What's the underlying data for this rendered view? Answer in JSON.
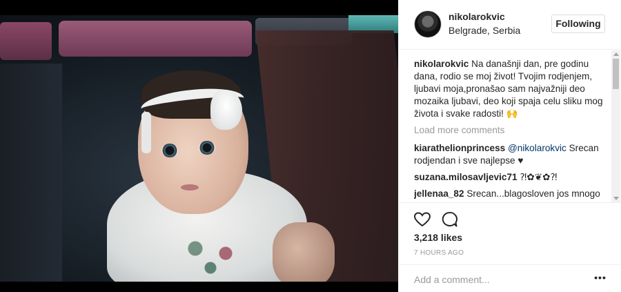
{
  "post": {
    "username": "nikolarokvic",
    "location": "Belgrade, Serbia",
    "follow_label": "Following",
    "caption_author": "nikolarokvic",
    "caption_text": "Na današnji dan, pre godinu dana, rodio se moj život! Tvojim rodjenjem, ljubavi moja,pronašao sam najvažniji deo mozaika ljubavi, deo koji spaja celu sliku mog života i svake radosti! 🙌",
    "load_more": "Load more comments",
    "comments": [
      {
        "author": "kiarathelionprincess",
        "mention": "@nikolarokvic",
        "text": " Srecan rodjendan i sve najlepse ♥"
      },
      {
        "author": "suzana.milosavljevic71",
        "mention": "",
        "text": "⁈✿❦✿⁈"
      },
      {
        "author": "jellenaa_82",
        "mention": "",
        "text": "Srecan...blagosloven jos mnogo godine🙌🙌da Vam je ziva i zdrava😍😍😍"
      }
    ],
    "likes": "3,218 likes",
    "timestamp": "7 HOURS AGO",
    "add_comment_placeholder": "Add a comment...",
    "more_label": "•••"
  },
  "icons": {
    "like": "heart-icon",
    "comment": "comment-bubble-icon",
    "more": "more-options-icon"
  },
  "colors": {
    "text": "#262626",
    "secondary": "#999999",
    "mention": "#003569",
    "border": "#efefef"
  }
}
